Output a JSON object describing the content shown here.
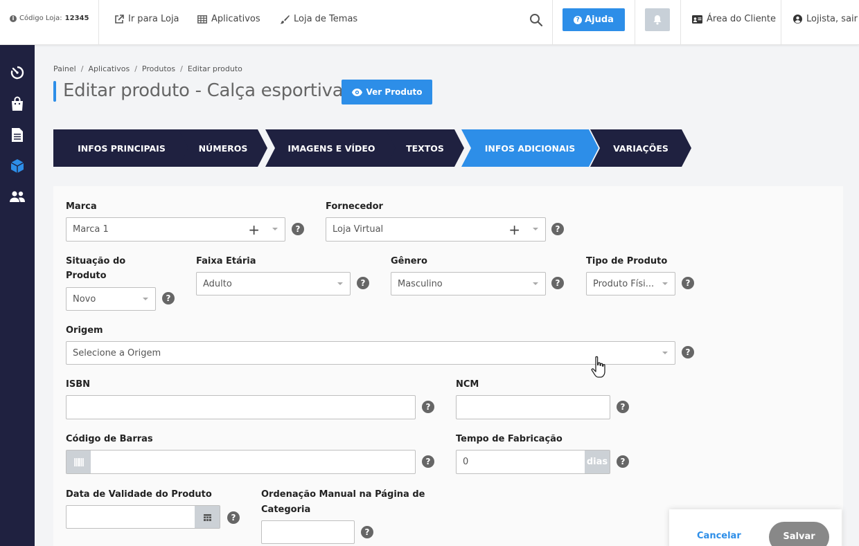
{
  "topbar": {
    "store_code_label": "Código Loja:",
    "store_code_value": "12345",
    "links": [
      "Ir para Loja",
      "Aplicativos",
      "Loja de Temas"
    ],
    "help_label": "Ajuda",
    "client_area_label": "Área do Cliente",
    "user_label": "Lojista, sair"
  },
  "sidebar": {
    "icons": [
      "dashboard-timer-icon",
      "shopping-bag-icon",
      "document-icon",
      "box-icon",
      "users-icon"
    ]
  },
  "breadcrumb": [
    "Painel",
    "Aplicativos",
    "Produtos",
    "Editar produto"
  ],
  "page": {
    "title": "Editar produto - Calça esportiva",
    "view_button": "Ver Produto"
  },
  "steps": [
    "INFOS PRINCIPAIS",
    "NÚMEROS",
    "IMAGENS E VÍDEO",
    "TEXTOS",
    "INFOS ADICIONAIS",
    "VARIAÇÕES"
  ],
  "active_step": "INFOS ADICIONAIS",
  "form": {
    "marca": {
      "label": "Marca",
      "value": "Marca 1"
    },
    "fornecedor": {
      "label": "Fornecedor",
      "value": "Loja Virtual"
    },
    "situacao": {
      "label_line1": "Situação do",
      "label_line2": "Produto",
      "value": "Novo"
    },
    "faixa": {
      "label": "Faixa Etária",
      "value": "Adulto"
    },
    "genero": {
      "label": "Gênero",
      "value": "Masculino"
    },
    "tipo": {
      "label": "Tipo de Produto",
      "value": "Produto Físi..."
    },
    "origem": {
      "label": "Origem",
      "value": "Selecione a Origem"
    },
    "isbn": {
      "label": "ISBN",
      "value": ""
    },
    "ncm": {
      "label": "NCM",
      "value": ""
    },
    "barcode": {
      "label": "Código de Barras",
      "value": ""
    },
    "fabricacao": {
      "label": "Tempo de Fabricação",
      "value": "0",
      "suffix": "dias"
    },
    "validade": {
      "label": "Data de Validade do Produto",
      "value": ""
    },
    "ordenacao": {
      "label_line1": "Ordenação Manual na Página de",
      "label_line2": "Categoria",
      "value": ""
    }
  },
  "footer": {
    "cancel_label": "Cancelar",
    "save_label": "Salvar"
  },
  "colors": {
    "accent": "#2d8ee8",
    "navy": "#1f2140"
  }
}
